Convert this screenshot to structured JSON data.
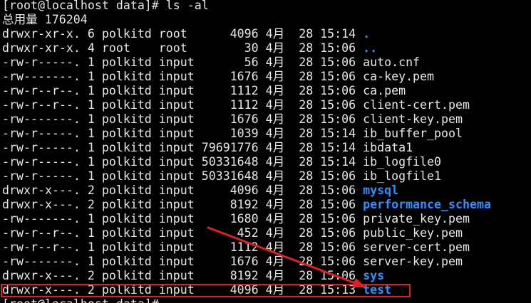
{
  "prompt": "[root@localhost data]# ls -al",
  "total": "总用量 176204",
  "listing": [
    {
      "perm": "drwxr-xr-x.",
      "links": "6",
      "owner": "polkitd",
      "group": "root",
      "size": "4096",
      "month": "4月",
      "day": "28",
      "time": "15:14",
      "name": ".",
      "kind": "dir"
    },
    {
      "perm": "drwxr-xr-x.",
      "links": "4",
      "owner": "root",
      "group": "root",
      "size": "30",
      "month": "4月",
      "day": "28",
      "time": "15:06",
      "name": "..",
      "kind": "dir"
    },
    {
      "perm": "-rw-r-----.",
      "links": "1",
      "owner": "polkitd",
      "group": "input",
      "size": "56",
      "month": "4月",
      "day": "28",
      "time": "15:06",
      "name": "auto.cnf",
      "kind": "file"
    },
    {
      "perm": "-rw-------.",
      "links": "1",
      "owner": "polkitd",
      "group": "input",
      "size": "1676",
      "month": "4月",
      "day": "28",
      "time": "15:06",
      "name": "ca-key.pem",
      "kind": "file"
    },
    {
      "perm": "-rw-r--r--.",
      "links": "1",
      "owner": "polkitd",
      "group": "input",
      "size": "1112",
      "month": "4月",
      "day": "28",
      "time": "15:06",
      "name": "ca.pem",
      "kind": "file"
    },
    {
      "perm": "-rw-r--r--.",
      "links": "1",
      "owner": "polkitd",
      "group": "input",
      "size": "1112",
      "month": "4月",
      "day": "28",
      "time": "15:06",
      "name": "client-cert.pem",
      "kind": "file"
    },
    {
      "perm": "-rw-------.",
      "links": "1",
      "owner": "polkitd",
      "group": "input",
      "size": "1676",
      "month": "4月",
      "day": "28",
      "time": "15:06",
      "name": "client-key.pem",
      "kind": "file"
    },
    {
      "perm": "-rw-r-----.",
      "links": "1",
      "owner": "polkitd",
      "group": "input",
      "size": "1039",
      "month": "4月",
      "day": "28",
      "time": "15:14",
      "name": "ib_buffer_pool",
      "kind": "file"
    },
    {
      "perm": "-rw-r-----.",
      "links": "1",
      "owner": "polkitd",
      "group": "input",
      "size": "79691776",
      "month": "4月",
      "day": "28",
      "time": "15:14",
      "name": "ibdata1",
      "kind": "file"
    },
    {
      "perm": "-rw-r-----.",
      "links": "1",
      "owner": "polkitd",
      "group": "input",
      "size": "50331648",
      "month": "4月",
      "day": "28",
      "time": "15:14",
      "name": "ib_logfile0",
      "kind": "file"
    },
    {
      "perm": "-rw-r-----.",
      "links": "1",
      "owner": "polkitd",
      "group": "input",
      "size": "50331648",
      "month": "4月",
      "day": "28",
      "time": "15:06",
      "name": "ib_logfile1",
      "kind": "file"
    },
    {
      "perm": "drwxr-x---.",
      "links": "2",
      "owner": "polkitd",
      "group": "input",
      "size": "4096",
      "month": "4月",
      "day": "28",
      "time": "15:06",
      "name": "mysql",
      "kind": "dir"
    },
    {
      "perm": "drwxr-x---.",
      "links": "2",
      "owner": "polkitd",
      "group": "input",
      "size": "8192",
      "month": "4月",
      "day": "28",
      "time": "15:06",
      "name": "performance_schema",
      "kind": "dir"
    },
    {
      "perm": "-rw-------.",
      "links": "1",
      "owner": "polkitd",
      "group": "input",
      "size": "1680",
      "month": "4月",
      "day": "28",
      "time": "15:06",
      "name": "private_key.pem",
      "kind": "file"
    },
    {
      "perm": "-rw-r--r--.",
      "links": "1",
      "owner": "polkitd",
      "group": "input",
      "size": "452",
      "month": "4月",
      "day": "28",
      "time": "15:06",
      "name": "public_key.pem",
      "kind": "file"
    },
    {
      "perm": "-rw-r--r--.",
      "links": "1",
      "owner": "polkitd",
      "group": "input",
      "size": "1112",
      "month": "4月",
      "day": "28",
      "time": "15:06",
      "name": "server-cert.pem",
      "kind": "file"
    },
    {
      "perm": "-rw-------.",
      "links": "1",
      "owner": "polkitd",
      "group": "input",
      "size": "1676",
      "month": "4月",
      "day": "28",
      "time": "15:06",
      "name": "server-key.pem",
      "kind": "file"
    },
    {
      "perm": "drwxr-x---.",
      "links": "2",
      "owner": "polkitd",
      "group": "input",
      "size": "8192",
      "month": "4月",
      "day": "28",
      "time": "15:06",
      "name": "sys",
      "kind": "dir"
    },
    {
      "perm": "drwxr-x---.",
      "links": "2",
      "owner": "polkitd",
      "group": "input",
      "size": "4096",
      "month": "4月",
      "day": "28",
      "time": "15:13",
      "name": "test",
      "kind": "dir",
      "highlighted": true
    }
  ],
  "trailing_prompt": "[root@localhost data]#",
  "colors": {
    "background": "#000000",
    "text": "#e6e6e6",
    "directory": "#2f8fff",
    "annotation": "#e02020"
  },
  "annotation": {
    "shape": "rectangle-with-arrow",
    "target": "test"
  }
}
